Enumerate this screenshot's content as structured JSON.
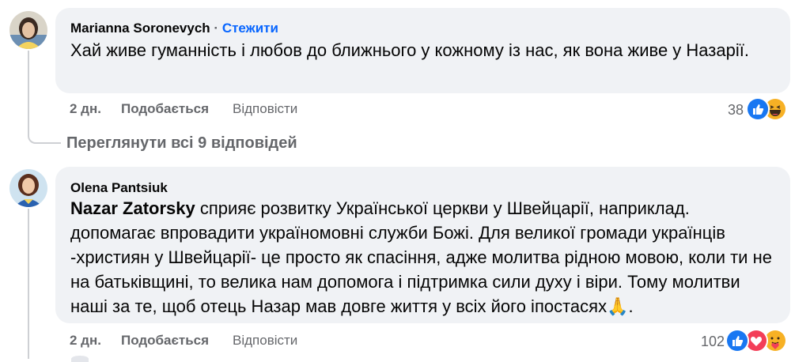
{
  "comments": [
    {
      "author": "Marianna Soronevych",
      "follow_separator": "·",
      "follow_label": "Стежити",
      "text": "Хай живе гуманність і любов до ближнього у кожному із нас, як вона живе у Назарії.",
      "time": "2 дн.",
      "like_label": "Подобається",
      "reply_label": "Відповісти",
      "reaction_count": "38",
      "reactions": [
        "like-icon",
        "haha-icon"
      ]
    },
    {
      "author": "Olena Pantsiuk",
      "mention": "Nazar Zatorsky",
      "text": " сприяє розвитку Української церкви у Швейцарії, наприклад. допомагає впровадити україномовні служби Божі. Для великої громади українців -християн у Швейцарії- це просто як спасіння, адже молитва рідною мовою, коли ти не на батьківщині, то велика нам допомога і підтримка сили духу і віри. Тому молитви наші за те, щоб отець Назар мав довге життя у всіх його іпостасях",
      "text_emoji": "🙏",
      "text_end": ".",
      "time": "2 дн.",
      "like_label": "Подобається",
      "reply_label": "Відповісти",
      "reaction_count": "102",
      "reactions": [
        "like-icon",
        "love-icon",
        "care-icon"
      ]
    }
  ],
  "view_replies_label": "Переглянути всі 9 відповідей",
  "colors": {
    "link": "#0866ff",
    "bubble": "#f0f2f5",
    "muted": "#65676b",
    "like": "#1877f2",
    "love": "#f33e58",
    "haha": "#f7b125"
  }
}
